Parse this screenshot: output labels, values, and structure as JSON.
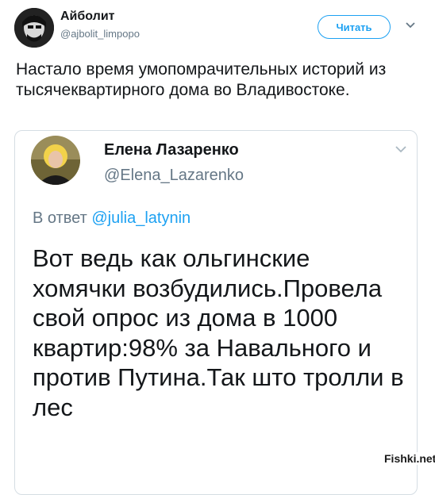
{
  "author": {
    "name": "Айболит",
    "handle": "@ajbolit_limpopo"
  },
  "actions": {
    "follow_label": "Читать"
  },
  "tweet": {
    "text": "Настало время умопомрачительных историй из тысячеквартирного дома во Владивостоке."
  },
  "quoted": {
    "name": "Елена Лазаренко",
    "handle": "@Elena_Lazarenko",
    "reply_prefix": "В ответ",
    "reply_to": "@julia_latynin",
    "body": "Вот ведь как ольгинские хомячки возбудились.Провела свой опрос из дома в 1000 квартир:98% за Навального и против Путина.Так што тролли в лес"
  },
  "watermark": "Fishki.net",
  "colors": {
    "accent": "#1da1f2",
    "secondary_text": "#657786",
    "border": "#d5dde3"
  },
  "icons": {
    "menu": "chevron-down-icon"
  }
}
